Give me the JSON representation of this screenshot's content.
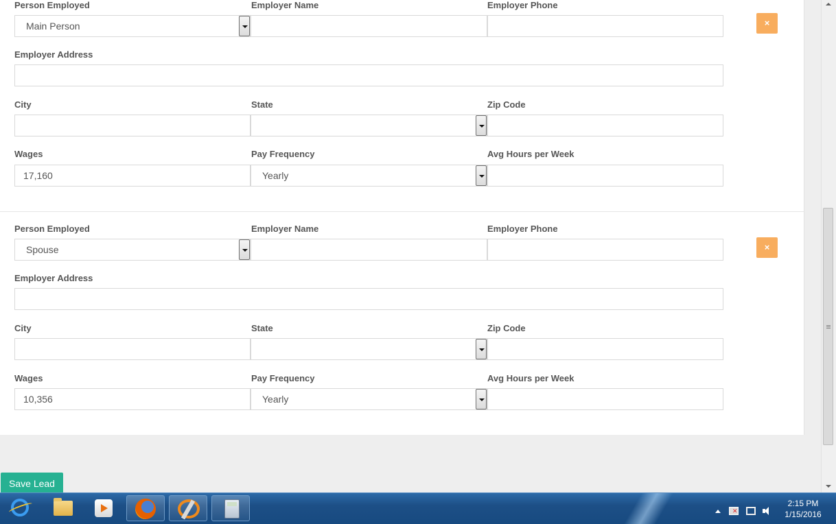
{
  "employers": [
    {
      "labels": {
        "person_employed": "Person Employed",
        "employer_name": "Employer Name",
        "employer_phone": "Employer Phone",
        "employer_address": "Employer Address",
        "city": "City",
        "state": "State",
        "zip_code": "Zip Code",
        "wages": "Wages",
        "pay_frequency": "Pay Frequency",
        "avg_hours": "Avg Hours per Week"
      },
      "values": {
        "person_employed": "Main Person",
        "employer_name": "",
        "employer_phone": "",
        "employer_address": "",
        "city": "",
        "state": "",
        "zip_code": "",
        "wages": "17,160",
        "pay_frequency": "Yearly",
        "avg_hours": ""
      },
      "remove_label": "×"
    },
    {
      "labels": {
        "person_employed": "Person Employed",
        "employer_name": "Employer Name",
        "employer_phone": "Employer Phone",
        "employer_address": "Employer Address",
        "city": "City",
        "state": "State",
        "zip_code": "Zip Code",
        "wages": "Wages",
        "pay_frequency": "Pay Frequency",
        "avg_hours": "Avg Hours per Week"
      },
      "values": {
        "person_employed": "Spouse",
        "employer_name": "",
        "employer_phone": "",
        "employer_address": "",
        "city": "",
        "state": "",
        "zip_code": "",
        "wages": "10,356",
        "pay_frequency": "Yearly",
        "avg_hours": ""
      },
      "remove_label": "×"
    }
  ],
  "actions": {
    "save_label": "Save Lead"
  },
  "taskbar": {
    "apps": [
      "internet-explorer-icon",
      "file-explorer-icon",
      "media-player-icon",
      "firefox-icon",
      "crm-app-icon",
      "calculator-icon"
    ],
    "clock_time": "2:15 PM",
    "clock_date": "1/15/2016"
  },
  "colors": {
    "remove_button": "#f8ad5e",
    "save_button": "#26b192",
    "taskbar": "#1d4f86"
  }
}
